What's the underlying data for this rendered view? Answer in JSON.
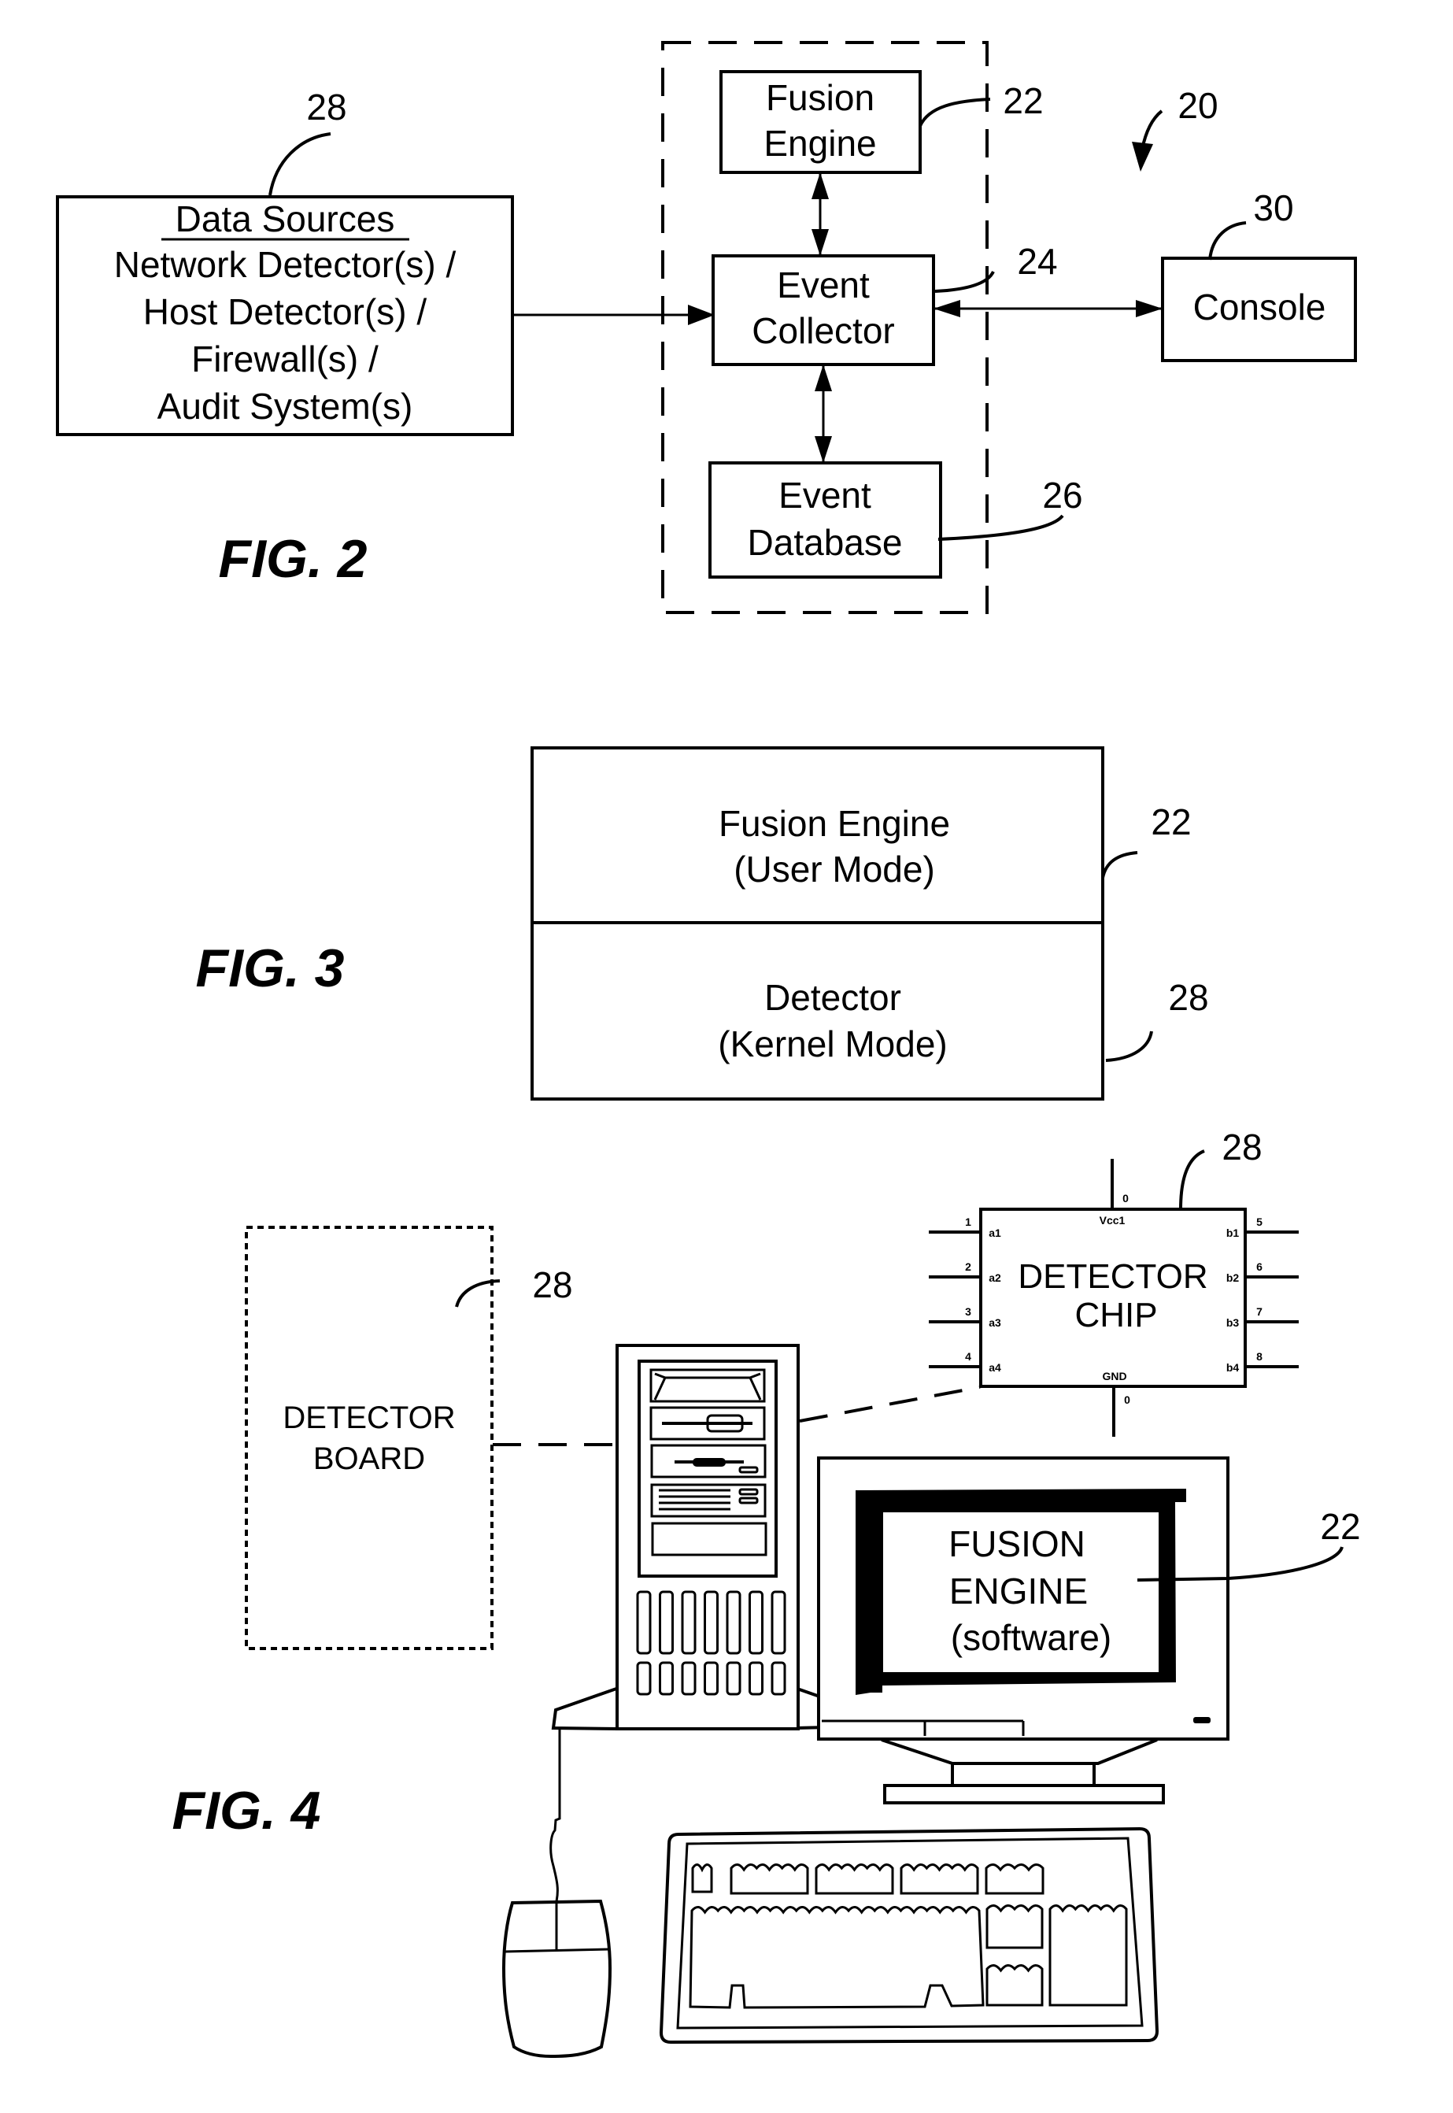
{
  "fig2": {
    "label": "FIG. 2",
    "system_ref": "20",
    "data_sources": {
      "ref": "28",
      "title": "Data Sources",
      "lines": [
        "Network Detector(s) /",
        "Host Detector(s) /",
        "Firewall(s) /",
        "Audit System(s)"
      ]
    },
    "fusion_engine": {
      "ref": "22",
      "lines": [
        "Fusion",
        "Engine"
      ]
    },
    "event_collector": {
      "ref": "24",
      "lines": [
        "Event",
        "Collector"
      ]
    },
    "event_database": {
      "ref": "26",
      "lines": [
        "Event",
        "Database"
      ]
    },
    "console": {
      "ref": "30",
      "label": "Console"
    }
  },
  "fig3": {
    "label": "FIG. 3",
    "upper": {
      "ref": "22",
      "lines": [
        "Fusion Engine",
        "(User Mode)"
      ]
    },
    "lower": {
      "ref": "28",
      "lines": [
        "Detector",
        "(Kernel Mode)"
      ]
    }
  },
  "fig4": {
    "label": "FIG. 4",
    "detector_board": {
      "ref": "28",
      "lines": [
        "DETECTOR",
        "BOARD"
      ]
    },
    "detector_chip": {
      "ref": "28",
      "lines": [
        "DETECTOR",
        "CHIP"
      ],
      "top_pin": {
        "number": "0",
        "name": "Vcc1"
      },
      "bottom_pin": {
        "number": "0",
        "name": "GND"
      },
      "left_pins": [
        {
          "number": "1",
          "name": "a1"
        },
        {
          "number": "2",
          "name": "a2"
        },
        {
          "number": "3",
          "name": "a3"
        },
        {
          "number": "4",
          "name": "a4"
        }
      ],
      "right_pins": [
        {
          "number": "5",
          "name": "b1"
        },
        {
          "number": "6",
          "name": "b2"
        },
        {
          "number": "7",
          "name": "b3"
        },
        {
          "number": "8",
          "name": "b4"
        }
      ]
    },
    "monitor_screen": {
      "ref": "22",
      "lines": [
        "FUSION",
        "ENGINE",
        "(software)"
      ]
    }
  }
}
